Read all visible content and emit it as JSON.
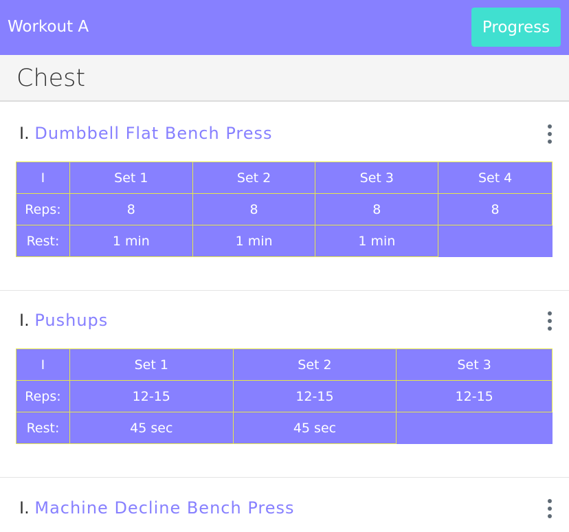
{
  "header": {
    "title": "Workout A",
    "progress_label": "Progress"
  },
  "section": {
    "title": "Chest"
  },
  "exercises": [
    {
      "number": "I.",
      "name": "Dumbbell Flat Bench Press",
      "table": {
        "corner": "I",
        "sets": [
          "Set 1",
          "Set 2",
          "Set 3",
          "Set 4"
        ],
        "reps_label": "Reps:",
        "reps": [
          "8",
          "8",
          "8",
          "8"
        ],
        "rest_label": "Rest:",
        "rest": [
          "1 min",
          "1 min",
          "1 min",
          ""
        ]
      }
    },
    {
      "number": "I.",
      "name": "Pushups",
      "table": {
        "corner": "I",
        "sets": [
          "Set 1",
          "Set 2",
          "Set 3"
        ],
        "reps_label": "Reps:",
        "reps": [
          "12-15",
          "12-15",
          "12-15"
        ],
        "rest_label": "Rest:",
        "rest": [
          "45 sec",
          "45 sec",
          ""
        ]
      }
    },
    {
      "number": "I.",
      "name": "Machine Decline Bench Press"
    }
  ],
  "icons": {
    "menu": "more-vertical-icon"
  },
  "colors": {
    "primary": "#8780ff",
    "accent": "#40e0d0",
    "table_border": "#e6e84a"
  }
}
